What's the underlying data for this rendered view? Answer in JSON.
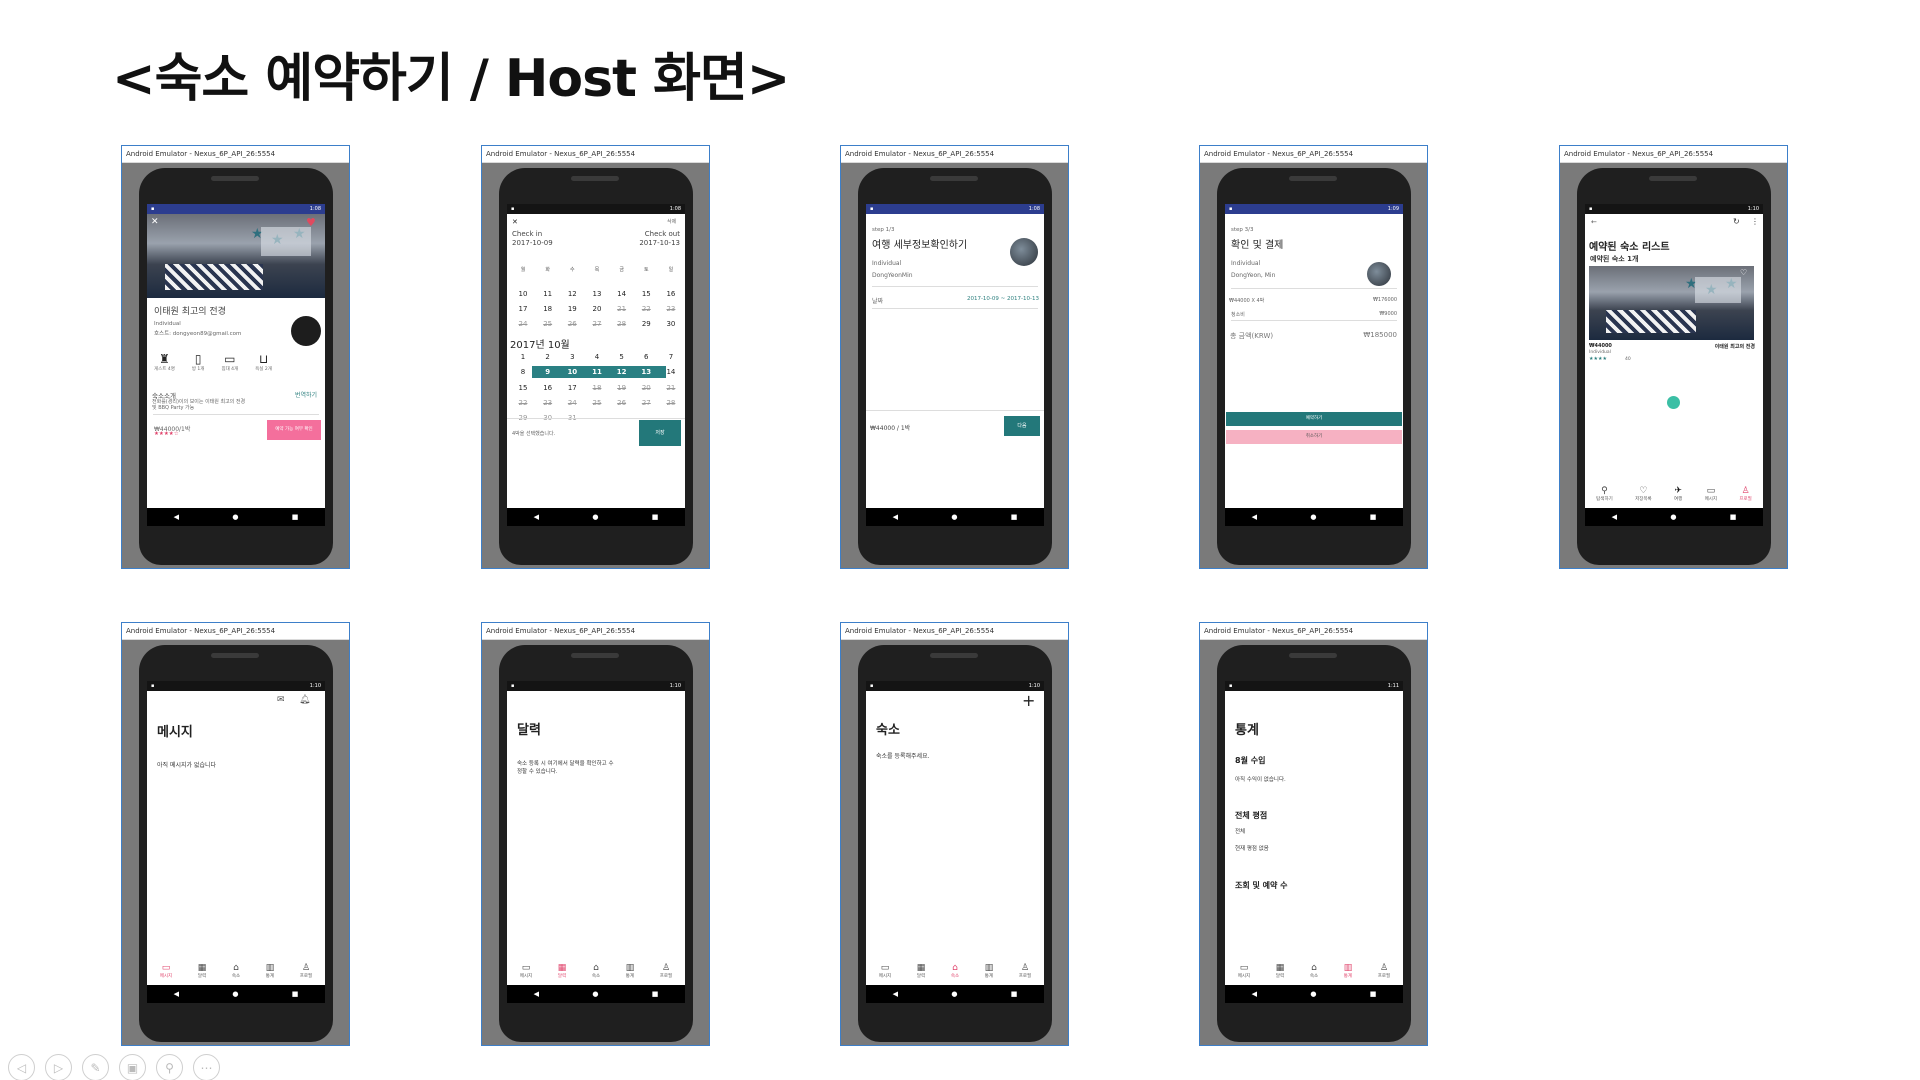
{
  "title": "<숙소 예약하기 / Host 화면>",
  "emulator_title": "Android Emulator - Nexus_6P_API_26:5554",
  "nav": {
    "back": "◀",
    "home": "●",
    "recent": "■"
  },
  "screens": {
    "s1": {
      "time": "1:08",
      "close": "✕",
      "name": "이태원 최고의 전경",
      "type": "Individual",
      "host": "호스트: dongyeon89@gmail.com",
      "amenities": [
        {
          "icon": "person-icon",
          "glyph": "♜",
          "label": "게스트 4명"
        },
        {
          "icon": "door-icon",
          "glyph": "▯",
          "label": "방 1개"
        },
        {
          "icon": "bed-icon",
          "glyph": "▭",
          "label": "침대 4개"
        },
        {
          "icon": "bath-icon",
          "glyph": "⊔",
          "label": "욕실 2개"
        }
      ],
      "intro_title": "숙소소개",
      "translate": "번역하기",
      "intro_body": "전화를(경리)이의 보이는 이태원 최고의 전경",
      "intro_body2": "및 BBQ Party 가능",
      "price": "₩44000/1박",
      "stars": "★★★★☆",
      "reserve_btn": "예약 가능 여부 확인"
    },
    "s2": {
      "time": "1:08",
      "close": "✕",
      "clear": "삭제",
      "check_in_label": "Check in",
      "check_in": "2017-10-09",
      "check_out_label": "Check out",
      "check_out": "2017-10-13",
      "weekdays": [
        "월",
        "화",
        "수",
        "목",
        "금",
        "토",
        "일"
      ],
      "rows_top": [
        [
          "10",
          "11",
          "12",
          "13",
          "14",
          "15",
          "16"
        ],
        [
          "17",
          "18",
          "19",
          "20",
          "21",
          "22",
          "23"
        ],
        [
          "24",
          "25",
          "26",
          "27",
          "28",
          "29",
          "30"
        ]
      ],
      "month": "2017년 10월",
      "rows_oct": [
        [
          "1",
          "2",
          "3",
          "4",
          "5",
          "6",
          "7"
        ],
        [
          "8",
          "9",
          "10",
          "11",
          "12",
          "13",
          "14"
        ],
        [
          "15",
          "16",
          "17",
          "18",
          "19",
          "20",
          "21"
        ],
        [
          "22",
          "23",
          "24",
          "25",
          "26",
          "27",
          "28"
        ],
        [
          "29",
          "30",
          "31",
          "",
          "",
          "",
          ""
        ]
      ],
      "footer_text": "4박을 선택했습니다.",
      "save": "저장"
    },
    "s3": {
      "time": "1:08",
      "step": "step 1/3",
      "title": "여행 세부정보확인하기",
      "type": "Individual",
      "host": "DongYeonMin",
      "date_label": "날짜",
      "date_value": "2017-10-09 ~ 2017-10-13",
      "price": "₩44000 / 1박",
      "next": "다음"
    },
    "s4": {
      "time": "1:09",
      "step": "step 3/3",
      "title": "확인 및 결제",
      "type": "Individual",
      "host": "DongYeon, Min",
      "line1_label": "₩44000 X 4박",
      "line1_value": "₩176000",
      "line2_label": "청소비",
      "line2_value": "₩9000",
      "total_label": "총 금액(KRW)",
      "total_value": "₩185000",
      "pay_btn": "예약하기",
      "cancel_btn": "취소하기"
    },
    "s5": {
      "time": "1:10",
      "title": "예약된 숙소 리스트",
      "subtitle": "예약된 숙소 1개",
      "price": "₩44000",
      "name": "이태원 최고의 전경",
      "type": "Individual",
      "stars": "★★★★",
      "reviews": "40",
      "tabs": [
        {
          "icon": "search-icon",
          "glyph": "⚲",
          "label": "탐색하기"
        },
        {
          "icon": "heart-icon",
          "glyph": "♡",
          "label": "저장목록"
        },
        {
          "icon": "plane-icon",
          "glyph": "✈",
          "label": "여행"
        },
        {
          "icon": "message-icon",
          "glyph": "▭",
          "label": "메시지"
        },
        {
          "icon": "profile-icon",
          "glyph": "♙",
          "label": "프로필"
        }
      ]
    },
    "s6": {
      "time": "1:10",
      "title": "메시지",
      "body": "아직 메시지가 없습니다"
    },
    "s7": {
      "time": "1:10",
      "title": "달력",
      "body": "숙소 등록 시 여기에서 달력을 확인하고 수",
      "body2": "정할 수 있습니다."
    },
    "s8": {
      "time": "1:10",
      "plus": "+",
      "title": "숙소",
      "body": "숙소를 등록해주세요."
    },
    "s9": {
      "time": "1:11",
      "title": "통계",
      "h1": "8월 수입",
      "b1": "아직 수익이 없습니다.",
      "h2": "전체 평점",
      "b2a": "전체",
      "b2b": "현재 평점 없음",
      "h3": "조회 및 예약 수"
    },
    "host_tabs": [
      {
        "icon": "message-icon",
        "glyph": "▭",
        "label": "메시지"
      },
      {
        "icon": "calendar-icon",
        "glyph": "▦",
        "label": "달력"
      },
      {
        "icon": "home-icon",
        "glyph": "⌂",
        "label": "숙소"
      },
      {
        "icon": "chart-icon",
        "glyph": "▥",
        "label": "통계"
      },
      {
        "icon": "profile-icon",
        "glyph": "♙",
        "label": "프로필"
      }
    ]
  },
  "ppt_controls": [
    "◁",
    "▷",
    "✎",
    "▣",
    "⚲",
    "⋯"
  ]
}
